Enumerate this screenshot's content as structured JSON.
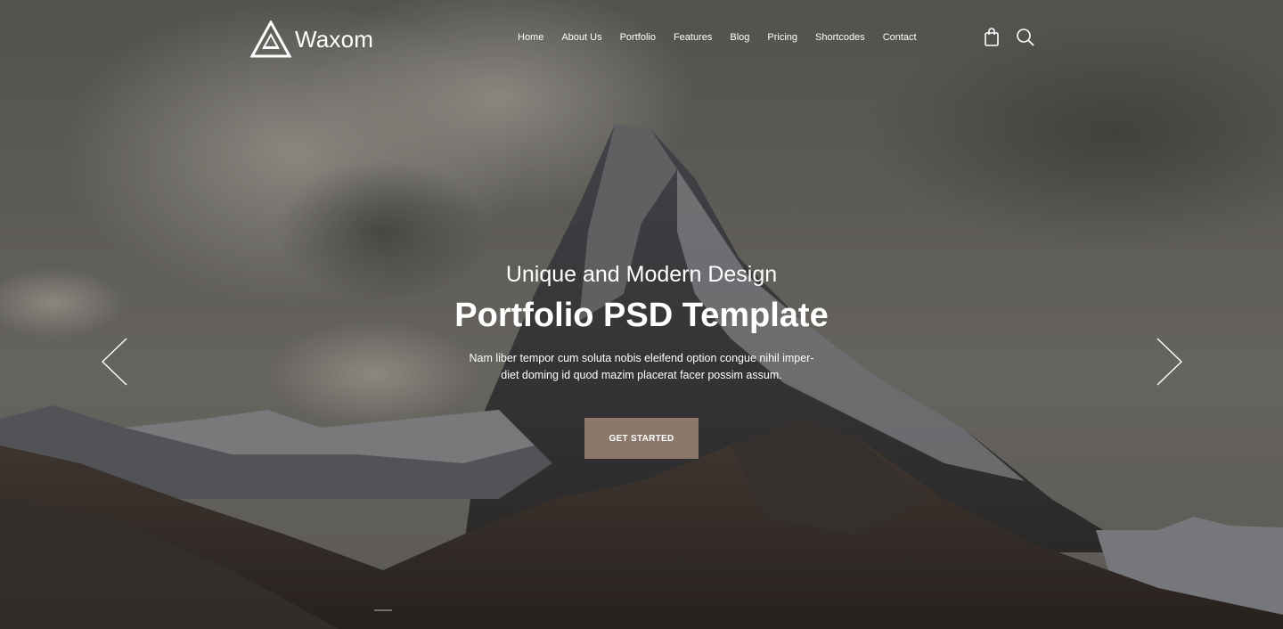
{
  "brand": {
    "name": "Waxom"
  },
  "nav": {
    "items": [
      {
        "label": "Home"
      },
      {
        "label": "About Us"
      },
      {
        "label": "Portfolio"
      },
      {
        "label": "Features"
      },
      {
        "label": "Blog"
      },
      {
        "label": "Pricing"
      },
      {
        "label": "Shortcodes"
      },
      {
        "label": "Contact"
      }
    ]
  },
  "header_icons": [
    "shopping-bag-icon",
    "search-icon"
  ],
  "hero": {
    "subtitle": "Unique and Modern Design",
    "title": "Portfolio PSD Template",
    "description_line1": "Nam liber tempor cum soluta nobis eleifend option congue nihil imper-",
    "description_line2": "diet doming id quod mazim placerat facer possim assum.",
    "cta_label": "GET STARTED",
    "prev_icon": "chevron-left-icon",
    "next_icon": "chevron-right-icon"
  },
  "colors": {
    "accent": "#8c786a",
    "text": "#ffffff"
  }
}
